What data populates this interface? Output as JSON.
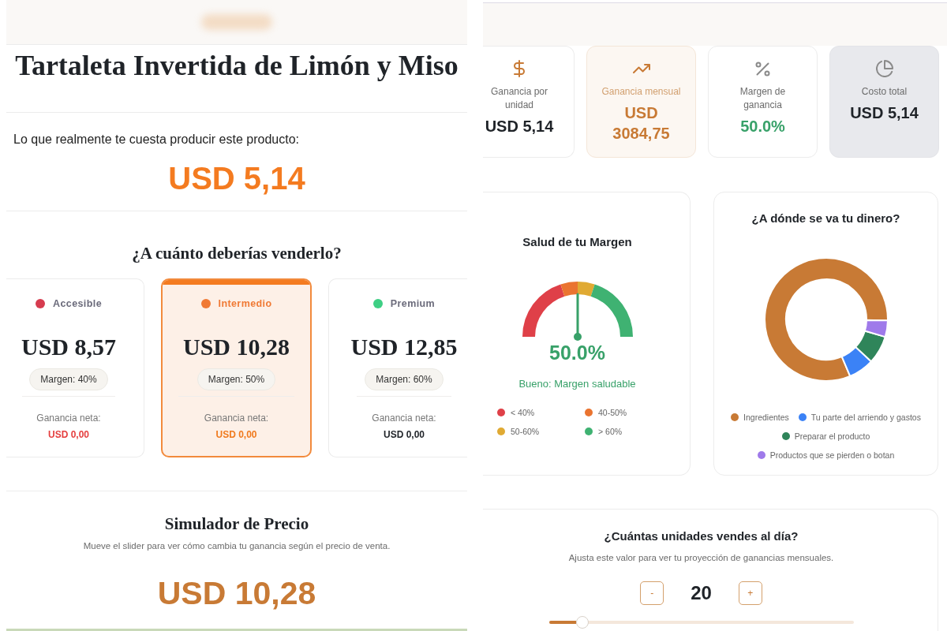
{
  "left_panel": {
    "product_title": "Tartaleta Invertida de Limón y Miso",
    "cost": {
      "label": "Lo que realmente te cuesta producir este producto:",
      "value": "USD 5,14"
    },
    "pricing": {
      "title": "¿A cuánto deberías venderlo?",
      "tiers": [
        {
          "name": "Accesible",
          "color": "#d63c4f",
          "selected": false,
          "price": "USD 8,57",
          "margin": "Margen: 40%",
          "profit_label": "Ganancia neta:",
          "profit": {
            "text": "USD 0,00",
            "color": "#e53e3e"
          }
        },
        {
          "name": "Intermedio",
          "color": "#f07a35",
          "selected": true,
          "price": "USD 10,28",
          "margin": "Margen: 50%",
          "profit_label": "Ganancia neta:",
          "profit": {
            "text": "USD 0,00",
            "color": "#f07a1e"
          }
        },
        {
          "name": "Premium",
          "color": "#3ecf84",
          "selected": false,
          "price": "USD 12,85",
          "margin": "Margen: 60%",
          "profit_label": "Ganancia neta:",
          "profit": {
            "text": "USD 0,00",
            "color": "#1f2328"
          }
        }
      ]
    },
    "simulator": {
      "title": "Simulador de Precio",
      "hint": "Mueve el slider para ver cómo cambia tu ganancia según el precio de venta.",
      "price": "USD 10,28"
    }
  },
  "right_panel": {
    "metrics": [
      {
        "kind": "unit",
        "label": "Ganancia por unidad",
        "value": "USD 5,14"
      },
      {
        "kind": "monthly",
        "label": "Ganancia mensual",
        "value": "USD 3084,75"
      },
      {
        "kind": "margin",
        "label": "Margen de ganancia",
        "value": "50.0%"
      },
      {
        "kind": "total",
        "label": "Costo total",
        "value": "USD 5,14"
      }
    ],
    "margin_health": {
      "title": "Salud de tu Margen",
      "level": 0.5,
      "value": "50.0%",
      "status": "Bueno: Margen saludable",
      "legend": [
        {
          "label": "< 40%",
          "color": "#df4048"
        },
        {
          "label": "40-50%",
          "color": "#ea7430"
        },
        {
          "label": "50-60%",
          "color": "#e0aa33"
        },
        {
          "label": "> 60%",
          "color": "#3fb272"
        }
      ]
    },
    "cost_breakdown": {
      "chart_data": {
        "type": "donut",
        "title": "¿A dónde se va tu dinero?",
        "categories": [
          "Ingredientes",
          "Tu parte del arriendo y gastos",
          "Preparar el producto",
          "Productos que se pierden o botan"
        ],
        "colors": [
          "#c87a35",
          "#3b82f6",
          "#2f855a",
          "#9f7aea"
        ],
        "series": [
          {
            "values": [
              81.6,
              6.7,
              7.4,
              4.3
            ]
          }
        ]
      }
    },
    "units": {
      "title": "¿Cuántas unidades vendes al día?",
      "hint": "Ajusta este valor para ver tu proyección de ganancias mensuales.",
      "decrement": "-",
      "value": "20",
      "increment": "+",
      "level": 0.11
    }
  }
}
